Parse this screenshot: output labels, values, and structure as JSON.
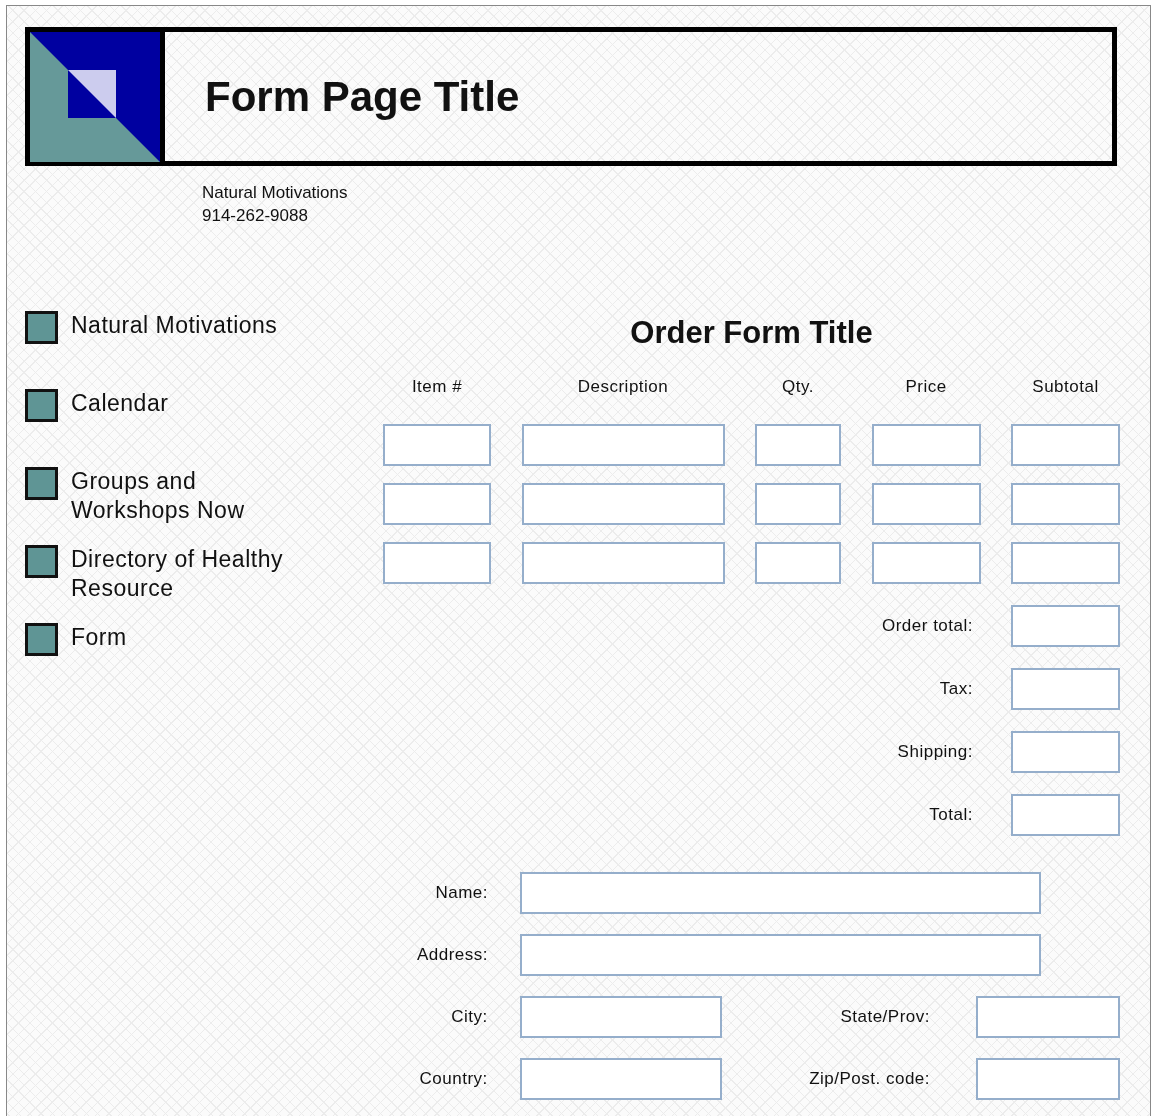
{
  "header": {
    "title": "Form Page Title",
    "company": "Natural Motivations",
    "phone": "914-262-9088"
  },
  "nav": [
    {
      "label": "Natural Motivations"
    },
    {
      "label": "Calendar"
    },
    {
      "label": "Groups and Workshops Now"
    },
    {
      "label": "Directory of Healthy Resource"
    },
    {
      "label": "Form"
    }
  ],
  "order_form": {
    "title": "Order Form Title",
    "columns": [
      "Item #",
      "Description",
      "Qty.",
      "Price",
      "Subtotal"
    ],
    "line_items": [
      {
        "kind": "blank"
      },
      {
        "kind": "blank"
      },
      {
        "kind": "blank"
      }
    ],
    "totals": [
      {
        "label": "Order total:"
      },
      {
        "label": "Tax:"
      },
      {
        "label": "Shipping:"
      },
      {
        "label": "Total:"
      }
    ],
    "customer": [
      [
        {
          "label": "Name:",
          "kind": "wide"
        }
      ],
      [
        {
          "label": "Address:",
          "kind": "wide"
        }
      ],
      [
        {
          "label": "City:",
          "kind": "medium"
        },
        {
          "label": "State/Prov:",
          "kind": "short"
        }
      ],
      [
        {
          "label": "Country:",
          "kind": "medium"
        },
        {
          "label": "Zip/Post. code:",
          "kind": "short"
        }
      ]
    ]
  }
}
